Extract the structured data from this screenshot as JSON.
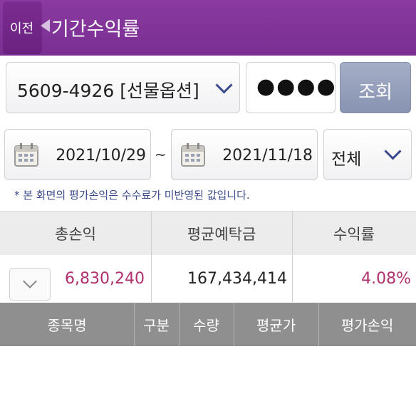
{
  "header": {
    "back_label": "이전",
    "title": "기간수익률"
  },
  "query": {
    "account": "5609-4926 [선물옵션]",
    "password_mask": "●●●●",
    "submit_label": "조회"
  },
  "period": {
    "start_date": "2021/10/29",
    "separator": "~",
    "end_date": "2021/11/18",
    "filter": "전체"
  },
  "notice": "* 본 화면의 평가손익은 수수료가 미반영된 값입니다.",
  "summary": {
    "headers": [
      "총손익",
      "평균예탁금",
      "수익률"
    ],
    "total_pnl": "6,830,240",
    "avg_deposit": "167,434,414",
    "return_rate": "4.08%"
  },
  "table": {
    "columns": [
      "종목명",
      "구분",
      "수량",
      "평균가",
      "평가손익"
    ]
  },
  "colors": {
    "header": "#7a2e92",
    "accent_value": "#b0306e",
    "link_blue": "#3a4a8a",
    "query_button": "#8893b2",
    "table_header": "#8f8f8f"
  }
}
